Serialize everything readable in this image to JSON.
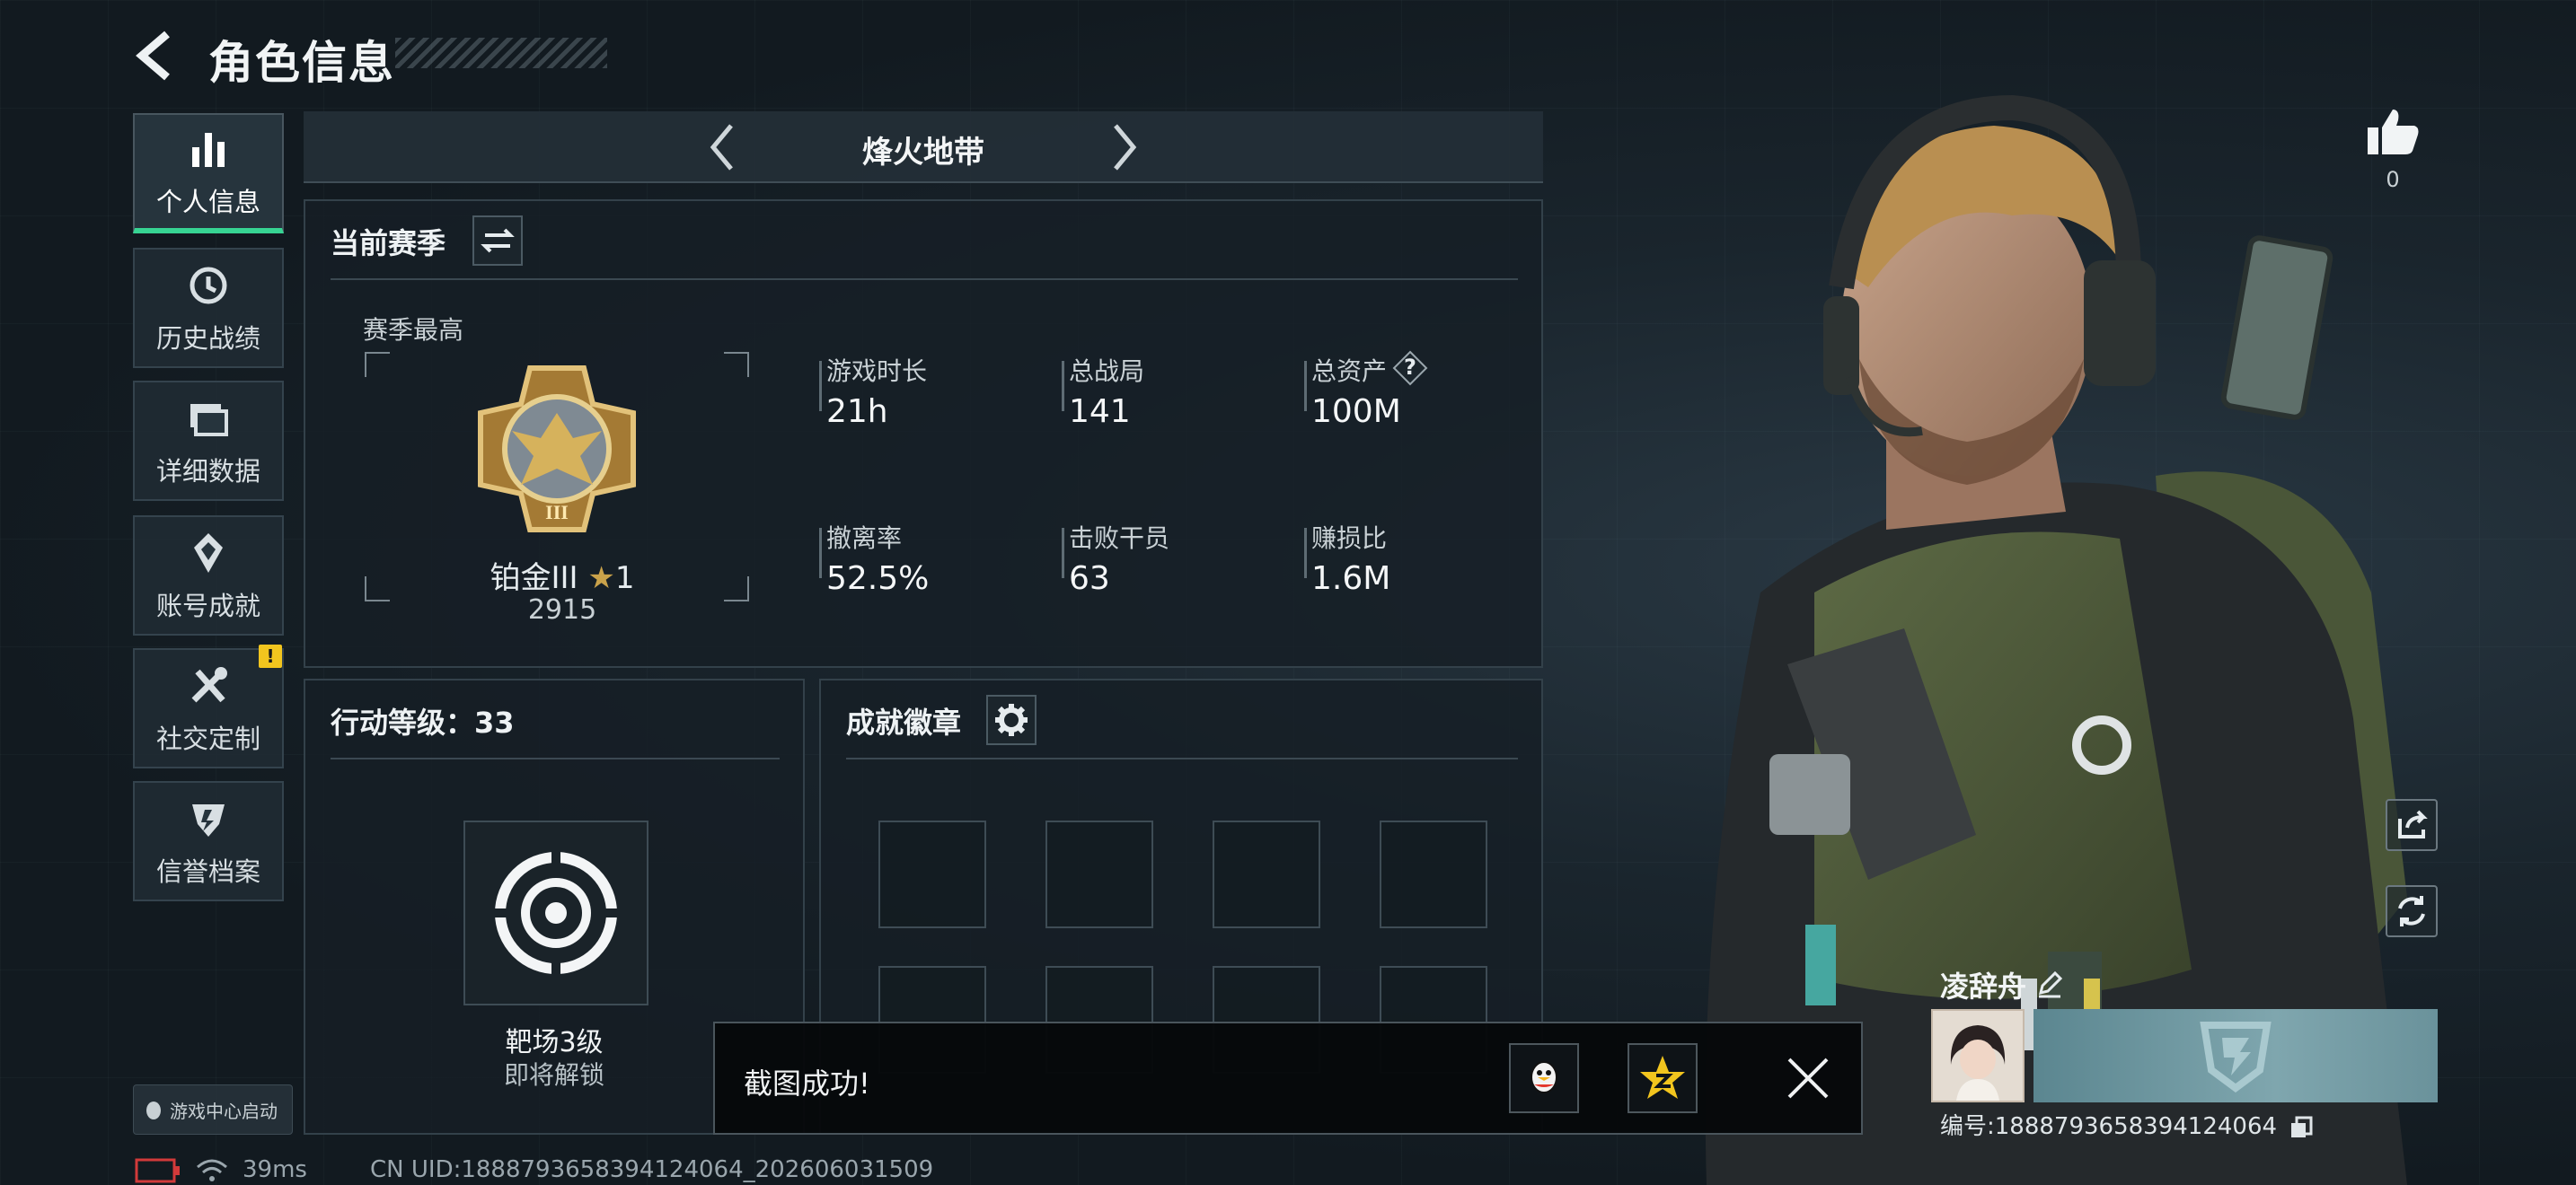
{
  "header": {
    "title": "角色信息"
  },
  "sidebar": {
    "items": [
      {
        "label": "个人信息",
        "icon": "bar-chart-icon",
        "active": true
      },
      {
        "label": "历史战绩",
        "icon": "history-icon"
      },
      {
        "label": "详细数据",
        "icon": "folders-icon"
      },
      {
        "label": "账号成就",
        "icon": "medal-icon"
      },
      {
        "label": "社交定制",
        "icon": "tools-icon",
        "badge": "!"
      },
      {
        "label": "信誉档案",
        "icon": "shield-icon"
      }
    ],
    "game_center_label": "游戏中心启动"
  },
  "mode_selector": {
    "current": "烽火地带"
  },
  "season_panel": {
    "title": "当前赛季",
    "best_label": "赛季最高",
    "rank": {
      "name": "铂金III",
      "stars": "1",
      "score": "2915",
      "tier_numeral": "III"
    },
    "stats": [
      {
        "label": "游戏时长",
        "value": "21h"
      },
      {
        "label": "总战局",
        "value": "141"
      },
      {
        "label": "总资产",
        "value": "100M",
        "help": "?"
      },
      {
        "label": "撤离率",
        "value": "52.5%"
      },
      {
        "label": "击败干员",
        "value": "63"
      },
      {
        "label": "赚损比",
        "value": "1.6M"
      }
    ]
  },
  "action_level": {
    "title": "行动等级：33",
    "item_title": "靶场3级",
    "item_subtitle": "即将解锁"
  },
  "achievements": {
    "title": "成就徽章"
  },
  "likes": {
    "count": "0"
  },
  "player": {
    "name": "凌辞舟",
    "id_text": "编号:1888793658394124064"
  },
  "toast": {
    "message": "截图成功!"
  },
  "status_bar": {
    "ping": "39ms",
    "uid": "CN UID:1888793658394124064_202606031509"
  },
  "colors": {
    "accent": "#37d493",
    "warning": "#f2c51e",
    "rank_gold": "#c9a24a"
  }
}
